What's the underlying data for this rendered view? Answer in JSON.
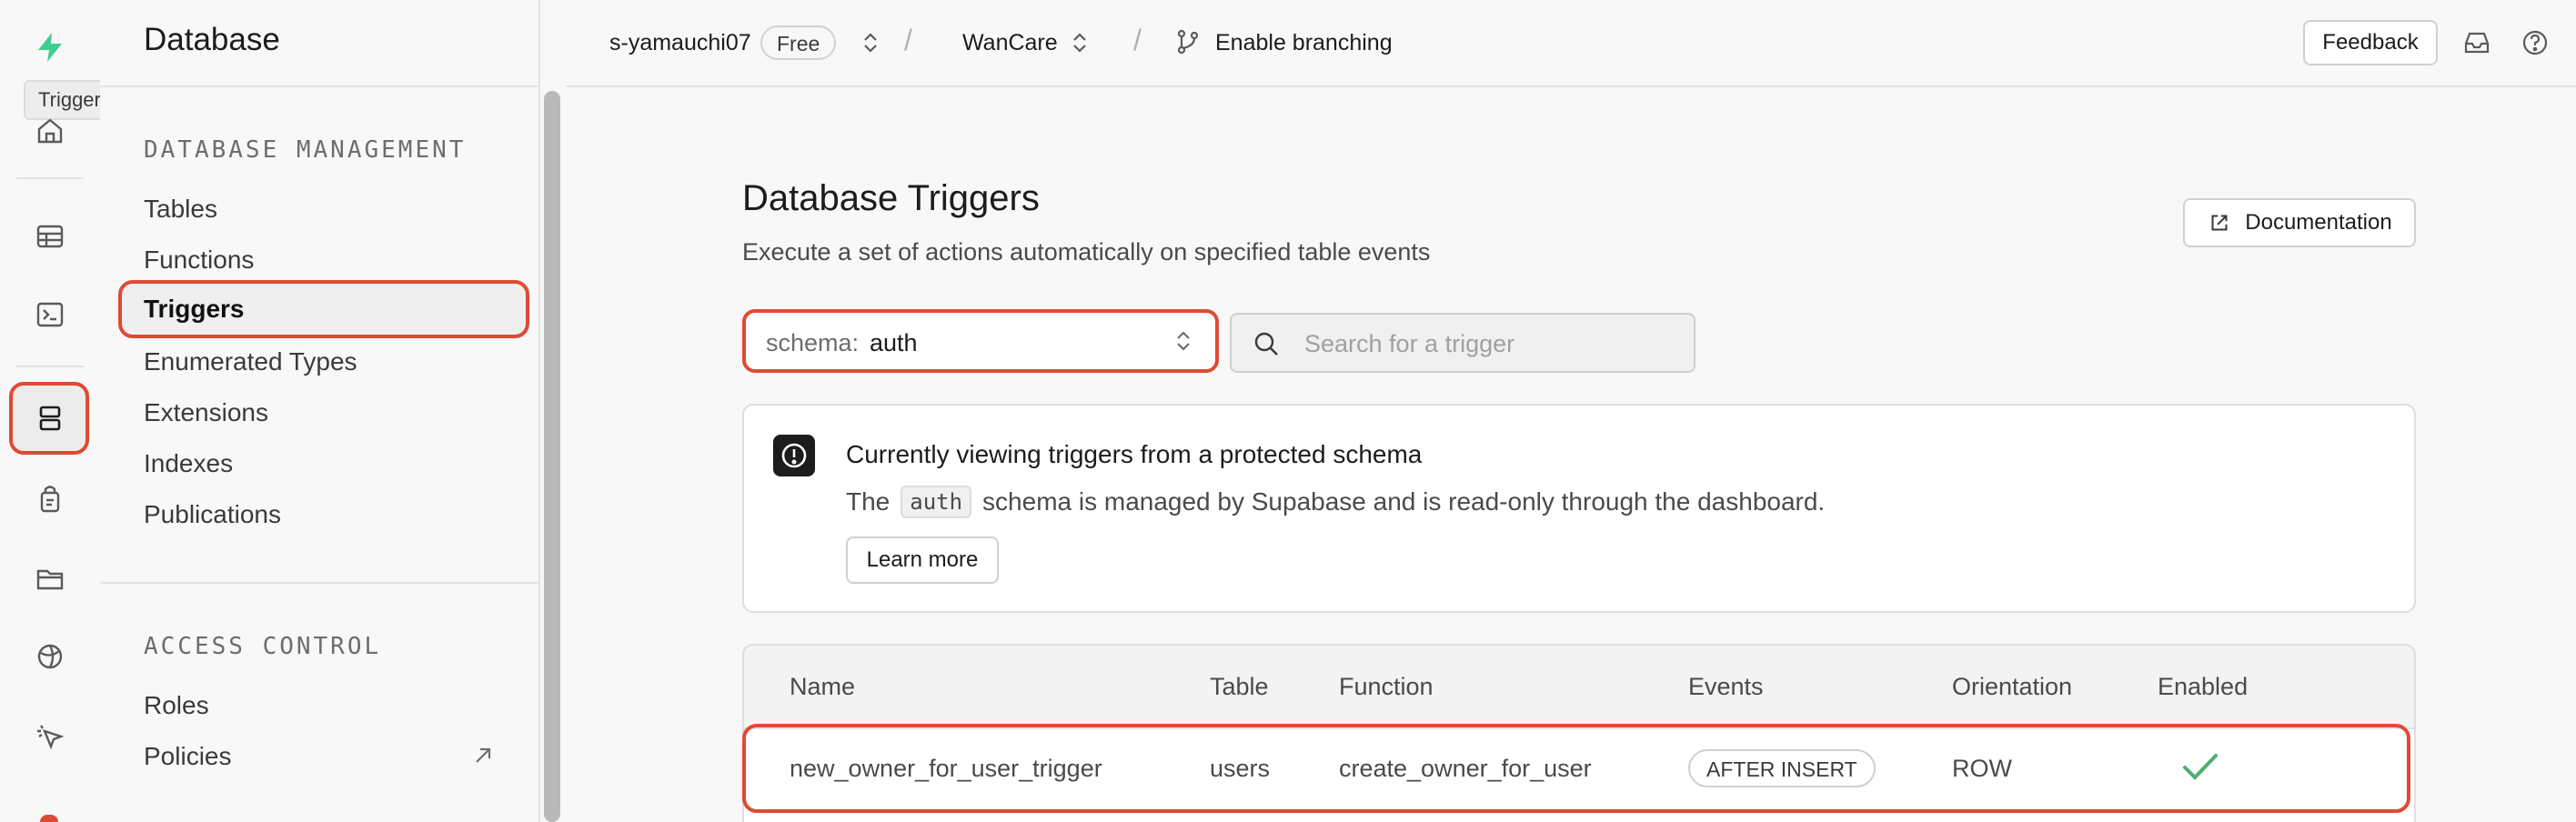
{
  "rail": {
    "tooltip": "Triggers"
  },
  "menu": {
    "title": "Database",
    "sections": [
      {
        "heading": "DATABASE MANAGEMENT",
        "items": [
          "Tables",
          "Functions",
          "Triggers",
          "Enumerated Types",
          "Extensions",
          "Indexes",
          "Publications"
        ]
      },
      {
        "heading": "ACCESS CONTROL",
        "items": [
          "Roles",
          "Policies"
        ]
      }
    ],
    "active_item": "Triggers"
  },
  "topbar": {
    "org": "s-yamauchi07",
    "plan": "Free",
    "project": "WanCare",
    "branching": "Enable branching",
    "feedback": "Feedback",
    "separator": "/"
  },
  "main": {
    "title": "Database Triggers",
    "description": "Execute a set of actions automatically on specified table events",
    "documentation": "Documentation",
    "schema_prefix": "schema:",
    "schema_value": "auth",
    "search_placeholder": "Search for a trigger",
    "alert": {
      "title": "Currently viewing triggers from a protected schema",
      "text_before": "The",
      "code": "auth",
      "text_after": "schema is managed by Supabase and is read-only through the dashboard.",
      "button": "Learn more"
    },
    "table": {
      "columns": [
        "Name",
        "Table",
        "Function",
        "Events",
        "Orientation",
        "Enabled"
      ],
      "rows": [
        {
          "name": "new_owner_for_user_trigger",
          "table": "users",
          "function": "create_owner_for_user",
          "events": "AFTER INSERT",
          "orientation": "ROW",
          "enabled": true
        }
      ]
    }
  },
  "colors": {
    "highlight": "#df4a33",
    "brand_green": "#3ecf8e",
    "check_green": "#4caf72"
  }
}
